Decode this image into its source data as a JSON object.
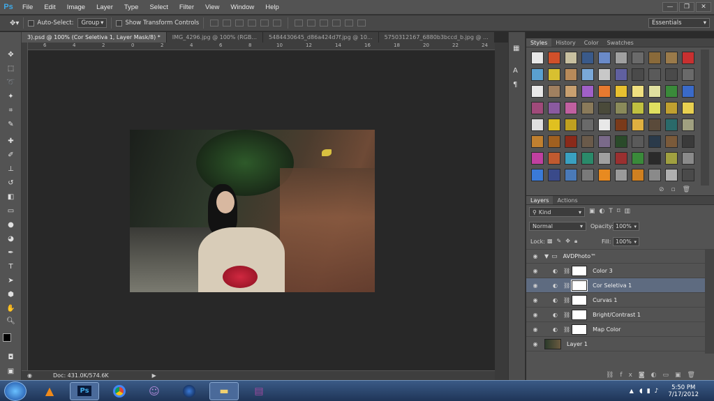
{
  "app": {
    "logo": "Ps"
  },
  "menu": [
    "File",
    "Edit",
    "Image",
    "Layer",
    "Type",
    "Select",
    "Filter",
    "View",
    "Window",
    "Help"
  ],
  "window_controls": {
    "minimize": "—",
    "restore": "❐",
    "close": "✕"
  },
  "options": {
    "auto_select_label": "Auto-Select:",
    "auto_select_value": "Group",
    "show_transform_label": "Show Transform Controls",
    "workspace": "Essentials"
  },
  "tabs": [
    "3).psd @ 100% (Cor Seletiva 1, Layer Mask/8) *",
    "IMG_4296.jpg @ 100% (RGB...",
    "5484430645_d86a424d7f.jpg @ 10...",
    "5750312167_6880b3bccd_b.jpg @ ..."
  ],
  "ruler_numbers": [
    "6",
    "4",
    "2",
    "0",
    "2",
    "4",
    "6",
    "8",
    "10",
    "12",
    "14",
    "16",
    "18",
    "20",
    "22",
    "24"
  ],
  "status": {
    "doc": "Doc: 431.0K/574.6K"
  },
  "styles_panel": {
    "tabs": [
      "Styles",
      "History",
      "Color",
      "Swatches"
    ],
    "swatches": [
      "#e8e8e8",
      "#d0502a",
      "#c8c0a0",
      "#3a5a8a",
      "#6a8ac8",
      "#a0a0a0",
      "#6a6a6a",
      "#8a6a3a",
      "#9a7a4a",
      "#c83030",
      "#5aa0d0",
      "#d8c030",
      "#b88a5a",
      "#7aa8d8",
      "#c8c8c8",
      "#6060a0",
      "#4a4a4a",
      "#5a5a5a",
      "#4a4a4a",
      "#6a6a6a",
      "#e8e8e8",
      "#a08060",
      "#c8a070",
      "#a060c8",
      "#e87a30",
      "#e8c030",
      "#f0e080",
      "#e0e0a0",
      "#3a8a3a",
      "#3a6ac8",
      "#a04a7a",
      "#8a5aa0",
      "#c060a0",
      "#8a7a5a",
      "#4a4a3a",
      "#8a8a5a",
      "#c0c040",
      "#e0e060",
      "#c0a030",
      "#e8d050",
      "#e0e0e0",
      "#e0c020",
      "#c0a020",
      "#6a6a6a",
      "#e8e8e8",
      "#7a3a1a",
      "#e0b040",
      "#5a4a3a",
      "#2a6a6a",
      "#a0a080",
      "#c08030",
      "#a06020",
      "#8a2a1a",
      "#6a5a4a",
      "#7a6a8a",
      "#2a4a2a",
      "#5a5a5a",
      "#2a3a4a",
      "#7a5a3a",
      "#3a3a3a",
      "#c040a0",
      "#c05a30",
      "#3aa0c0",
      "#2a8a6a",
      "#a0a0a0",
      "#9a3030",
      "#3a8a3a",
      "#2a2a2a",
      "#a0a040",
      "#8a8a8a",
      "#3a7ad8",
      "#3a4a8a",
      "#4a7ab8",
      "#7a7a7a",
      "#e88a20",
      "#9a9a9a",
      "#d08020",
      "#8a8a8a",
      "#b0b0b0",
      "#4a4a4a"
    ]
  },
  "layers_panel": {
    "tabs": [
      "Layers",
      "Actions"
    ],
    "kind_label": "Kind",
    "blend_mode": "Normal",
    "opacity_label": "Opacity:",
    "opacity_value": "100%",
    "lock_label": "Lock:",
    "fill_label": "Fill:",
    "fill_value": "100%",
    "group_name": "AVDPhoto™",
    "layers": [
      {
        "name": "Color 3",
        "selected": false
      },
      {
        "name": "Cor Seletiva 1",
        "selected": true
      },
      {
        "name": "Curvas 1",
        "selected": false
      },
      {
        "name": "Bright/Contrast 1",
        "selected": false
      },
      {
        "name": "Map Color",
        "selected": false
      }
    ],
    "base_layer": "Layer 1"
  },
  "taskbar": {
    "time": "5:50 PM",
    "date": "7/17/2012",
    "apps": [
      "vlc-icon",
      "photoshop-icon",
      "chrome-icon",
      "messenger-icon",
      "globe-icon",
      "folder-icon",
      "winrar-icon"
    ]
  }
}
